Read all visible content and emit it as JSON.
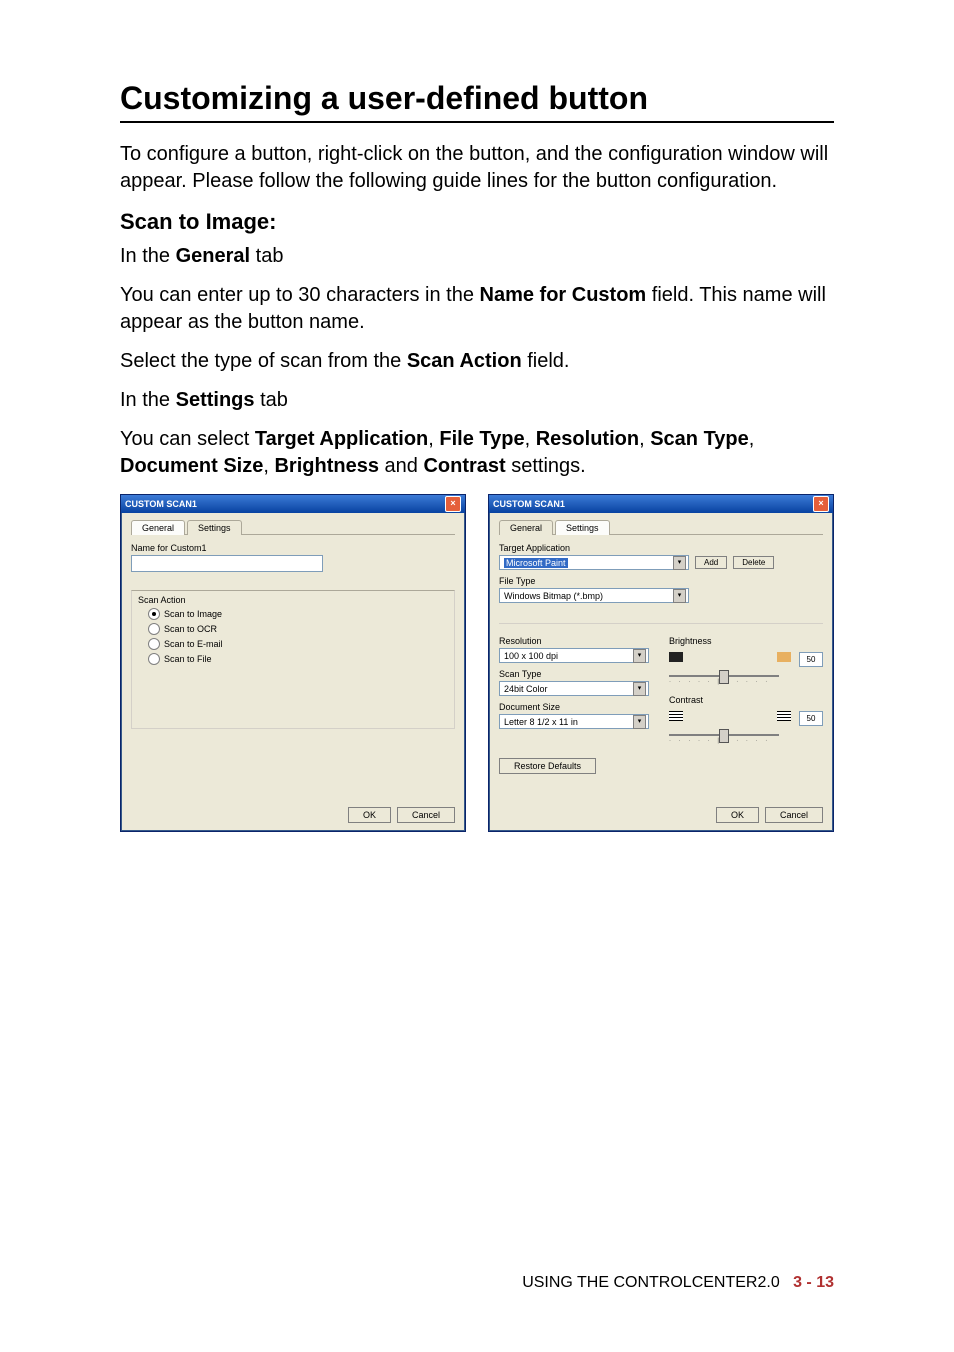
{
  "heading": "Customizing a user-defined button",
  "intro": "To configure a button, right-click on the button, and the configuration window will appear. Please follow the following guide lines for the button configuration.",
  "section_title": "Scan to Image:",
  "line_general_prefix": "In the ",
  "line_general_bold": "General",
  "line_general_suffix": " tab",
  "line_30chars_prefix": "You can enter up to 30 characters in the ",
  "line_30chars_bold": "Name for Custom",
  "line_30chars_suffix": " field. This name will appear as the button name.",
  "line_scanaction_prefix": "Select the type of scan from the ",
  "line_scanaction_bold": "Scan Action",
  "line_scanaction_suffix": " field.",
  "line_settings_prefix": "In the ",
  "line_settings_bold": "Settings",
  "line_settings_suffix": " tab",
  "line_options_prefix": "You can select ",
  "opts": {
    "target_app": "Target Application",
    "file_type": "File Type",
    "resolution": "Resolution",
    "scan_type": "Scan Type",
    "document_size": "Document Size",
    "brightness": "Brightness",
    "contrast": "Contrast"
  },
  "line_options_suffix": " settings.",
  "dialog1": {
    "title": "CUSTOM SCAN1",
    "tab_general": "General",
    "tab_settings": "Settings",
    "name_label": "Name for Custom1",
    "scan_action_label": "Scan Action",
    "radios": [
      "Scan to Image",
      "Scan to OCR",
      "Scan to E-mail",
      "Scan to File"
    ],
    "selected_radio": 0,
    "ok": "OK",
    "cancel": "Cancel"
  },
  "dialog2": {
    "title": "CUSTOM SCAN1",
    "tab_general": "General",
    "tab_settings": "Settings",
    "target_app_label": "Target Application",
    "target_app_value": "Microsoft Paint",
    "add": "Add",
    "delete": "Delete",
    "file_type_label": "File Type",
    "file_type_value": "Windows Bitmap (*.bmp)",
    "resolution_label": "Resolution",
    "resolution_value": "100 x 100 dpi",
    "scan_type_label": "Scan Type",
    "scan_type_value": "24bit Color",
    "document_size_label": "Document Size",
    "document_size_value": "Letter 8 1/2 x 11 in",
    "brightness_label": "Brightness",
    "brightness_value": "50",
    "contrast_label": "Contrast",
    "contrast_value": "50",
    "restore": "Restore Defaults",
    "ok": "OK",
    "cancel": "Cancel"
  },
  "footer_text": "USING THE CONTROLCENTER2.0",
  "footer_page": "3 - 13"
}
